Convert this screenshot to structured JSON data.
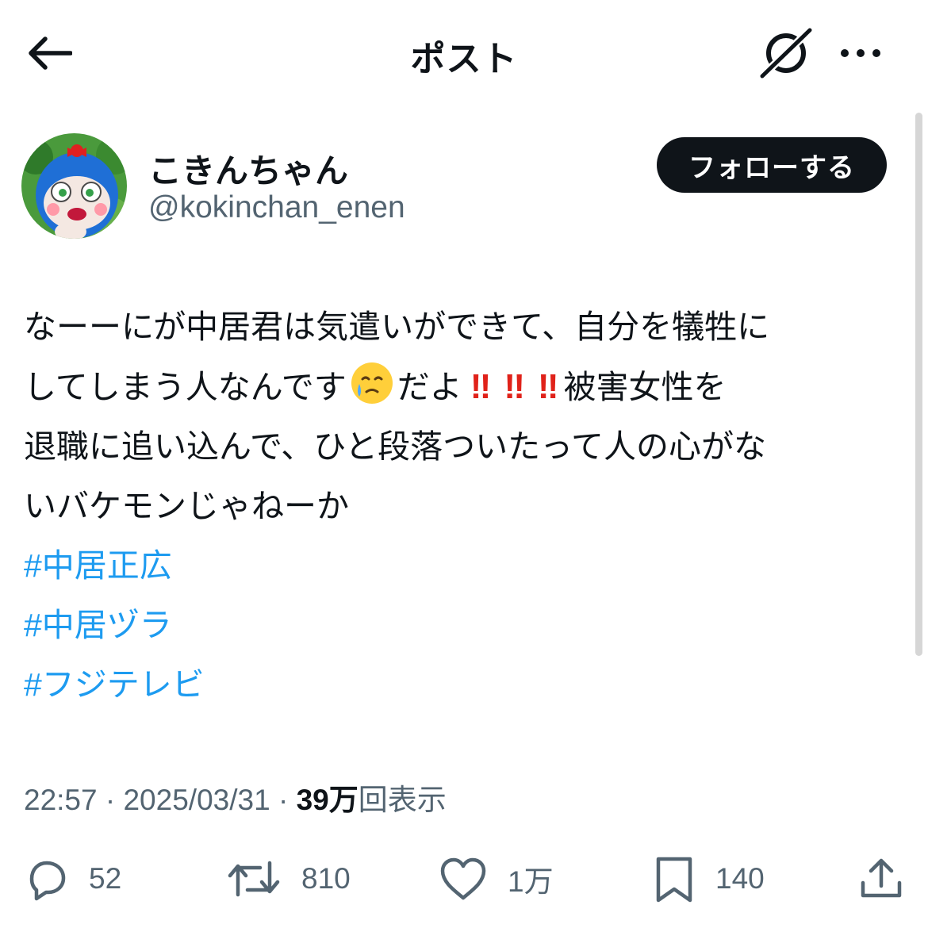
{
  "header": {
    "title": "ポスト"
  },
  "author": {
    "display_name": "こきんちゃん",
    "handle": "@kokinchan_enen",
    "follow_label": "フォローする"
  },
  "post": {
    "lines": [
      "なーーにが中居君は気遣いができて、自分を犠牲に",
      "してしまう人なんです",
      "だよ",
      "被害女性を",
      "退職に追い込んで、ひと段落ついたって人の心がな",
      "いバケモンじゃねーか"
    ],
    "emoji_face": "face-holding-back-tears-icon",
    "bangs": [
      "‼",
      "‼",
      "‼"
    ],
    "hashtags": [
      "#中居正広",
      "#中居ヅラ",
      "#フジテレビ"
    ]
  },
  "meta": {
    "time": "22:57",
    "date": "2025/03/31",
    "separator": "·",
    "views_count": "39万",
    "views_label": "回表示"
  },
  "actions": {
    "replies": "52",
    "reposts": "810",
    "likes": "1万",
    "bookmarks": "140"
  },
  "colors": {
    "text": "#0f1419",
    "secondary": "#536471",
    "link": "#1d9bf0",
    "exclamation": "#e0221a"
  }
}
